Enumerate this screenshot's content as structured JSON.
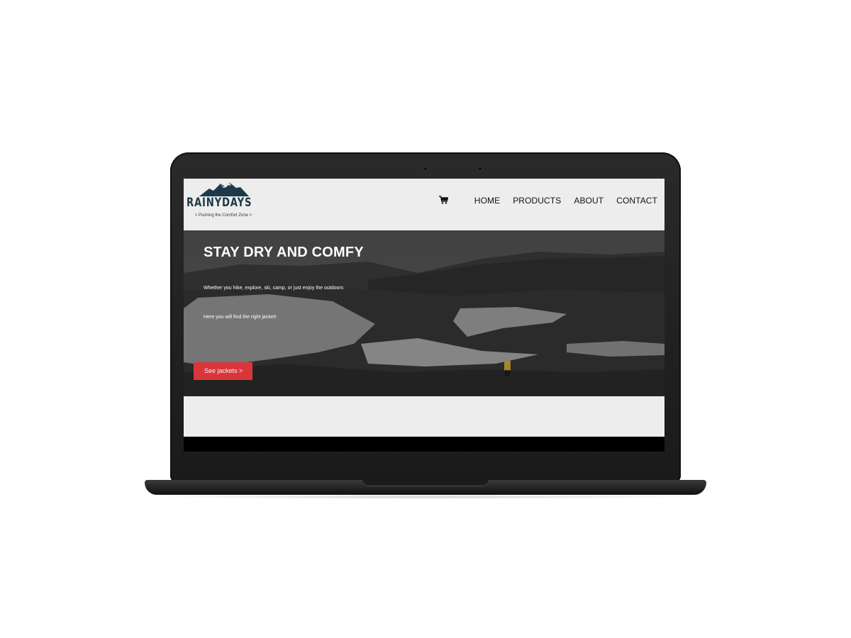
{
  "logo": {
    "wordmark": "RAINYDAYS",
    "tagline": "> Pushing the Comfort Zone >"
  },
  "nav": {
    "cart_icon": "shopping-cart-icon",
    "items": [
      {
        "label": "HOME"
      },
      {
        "label": "PRODUCTS"
      },
      {
        "label": "ABOUT"
      },
      {
        "label": "CONTACT"
      }
    ]
  },
  "hero": {
    "title": "STAY DRY AND COMFY",
    "line1": "Whether you hike, explore, ski, camp, or just enjoy the outdoors",
    "line2": "Here you will find the right jacket!",
    "button_label": "See jackets >"
  },
  "colors": {
    "brand": "#1d3a4a",
    "button": "#d9363b",
    "header_bg": "#ededed",
    "device": "#1a1a1a"
  }
}
